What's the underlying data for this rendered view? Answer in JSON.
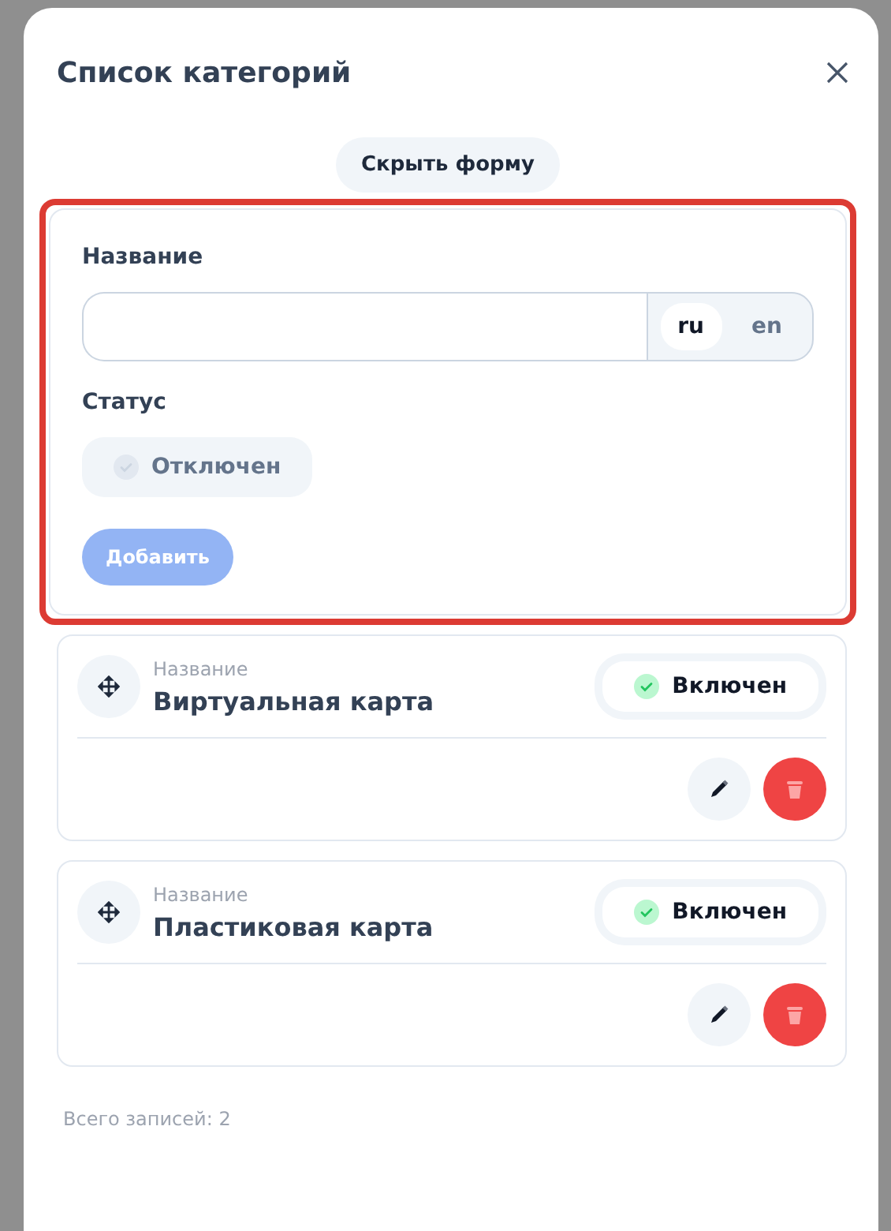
{
  "dialog": {
    "title": "Список категорий",
    "toggle_form_button": "Скрыть форму"
  },
  "form": {
    "name_label": "Название",
    "languages": [
      {
        "label": "ru",
        "selected": true
      },
      {
        "label": "en",
        "selected": false
      }
    ],
    "status_label": "Статус",
    "status": {
      "label": "Отключен",
      "on": false
    },
    "submit_button": {
      "label": "Добавить",
      "disabled": true
    }
  },
  "categories": [
    {
      "caption": "Название",
      "name": "Виртуальная карта",
      "status": {
        "label": "Включен",
        "on": true
      }
    },
    {
      "caption": "Название",
      "name": "Пластиковая карта",
      "status": {
        "label": "Включен",
        "on": true
      }
    }
  ],
  "footer": "Всего записей: 2"
}
